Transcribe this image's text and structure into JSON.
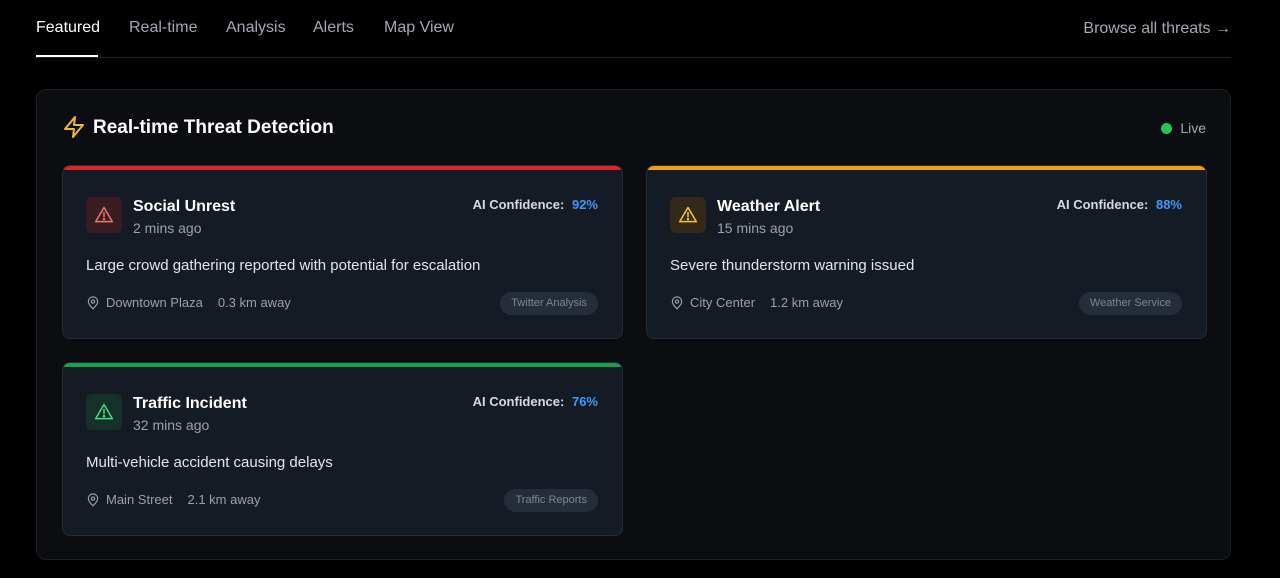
{
  "tabs": [
    {
      "label": "Featured",
      "active": true
    },
    {
      "label": "Real-time",
      "active": false
    },
    {
      "label": "Analysis",
      "active": false
    },
    {
      "label": "Alerts",
      "active": false
    },
    {
      "label": "Map View",
      "active": false
    }
  ],
  "browse_link": "Browse all threats →",
  "panel": {
    "title": "Real-time Threat Detection",
    "title_icon": "lightning-icon",
    "live_label": "Live"
  },
  "confidence_label": "AI Confidence:",
  "threats": [
    {
      "title": "Social Unrest",
      "time": "2 mins ago",
      "confidence": "92%",
      "description": "Large crowd gathering reported with potential for escalation",
      "location": "Downtown Plaza",
      "distance": "0.3 km away",
      "source": "Twitter Analysis",
      "severity_color": "#dc2626",
      "icon": "warning-triangle-icon"
    },
    {
      "title": "Weather Alert",
      "time": "15 mins ago",
      "confidence": "88%",
      "description": "Severe thunderstorm warning issued",
      "location": "City Center",
      "distance": "1.2 km away",
      "source": "Weather Service",
      "severity_color": "#f59e0b",
      "icon": "warning-triangle-icon"
    },
    {
      "title": "Traffic Incident",
      "time": "32 mins ago",
      "confidence": "76%",
      "description": "Multi-vehicle accident causing delays",
      "location": "Main Street",
      "distance": "2.1 km away",
      "source": "Traffic Reports",
      "severity_color": "#16a34a",
      "icon": "warning-triangle-icon"
    }
  ],
  "colors": {
    "accent_blue": "#3b9bff",
    "live_green": "#22c55e",
    "lightning_yellow": "#f5b731"
  }
}
